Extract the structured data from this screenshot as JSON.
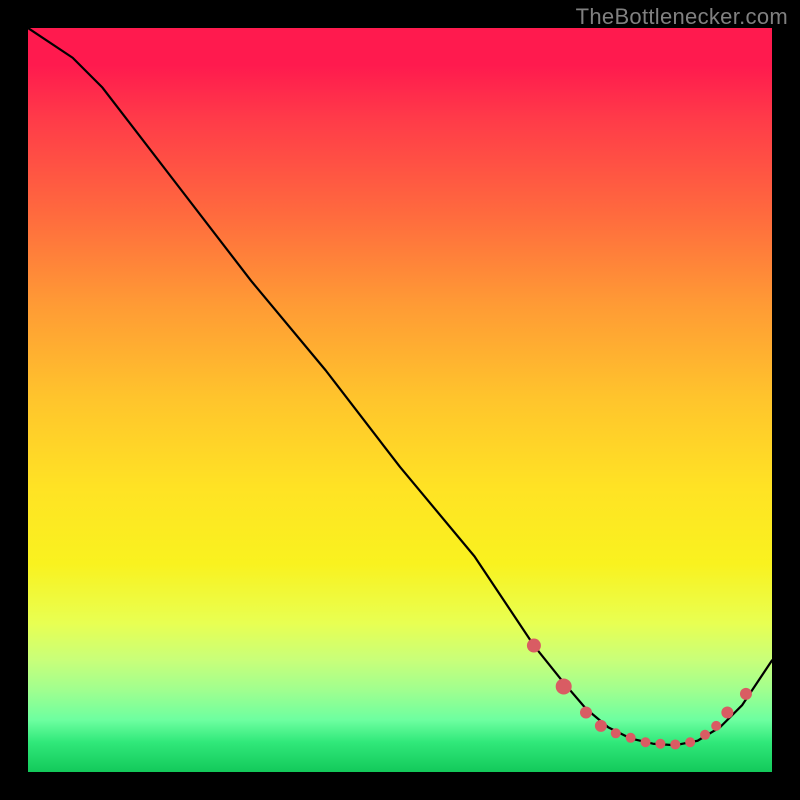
{
  "watermark": "TheBottlenecker.com",
  "chart_data": {
    "type": "line",
    "title": "",
    "xlabel": "",
    "ylabel": "",
    "xlim": [
      0,
      100
    ],
    "ylim": [
      0,
      100
    ],
    "x": [
      0,
      6,
      10,
      20,
      30,
      40,
      50,
      60,
      68,
      72,
      75,
      78,
      81,
      84,
      87,
      90,
      93,
      96,
      100
    ],
    "values": [
      100,
      96,
      92,
      79,
      66,
      54,
      41,
      29,
      17,
      12,
      8.5,
      6,
      4.5,
      3.8,
      3.6,
      4.2,
      6,
      9,
      15
    ],
    "series_name": "bottleneck-curve",
    "markers": {
      "x": [
        68,
        72,
        75,
        77,
        79,
        81,
        83,
        85,
        87,
        89,
        91,
        92.5,
        94,
        96.5
      ],
      "y": [
        17,
        11.5,
        8,
        6.2,
        5.2,
        4.6,
        4.0,
        3.8,
        3.7,
        4.0,
        5.0,
        6.2,
        8.0,
        10.5
      ],
      "sizes": [
        7,
        8,
        6,
        6,
        5,
        5,
        5,
        5,
        5,
        5,
        5,
        5,
        6,
        6
      ]
    },
    "background_gradient": {
      "stops": [
        {
          "pos": 0.0,
          "color": "#ff1a4e"
        },
        {
          "pos": 0.5,
          "color": "#ffc52c"
        },
        {
          "pos": 0.8,
          "color": "#e8ff52"
        },
        {
          "pos": 1.0,
          "color": "#13c95a"
        }
      ]
    }
  }
}
